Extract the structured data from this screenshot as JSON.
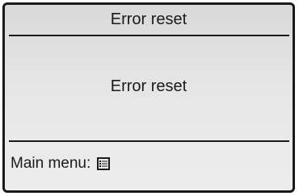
{
  "screen": {
    "title": "Error reset",
    "message": "Error reset",
    "footer_label": "Main menu:",
    "footer_icon": "menu-list-icon"
  }
}
